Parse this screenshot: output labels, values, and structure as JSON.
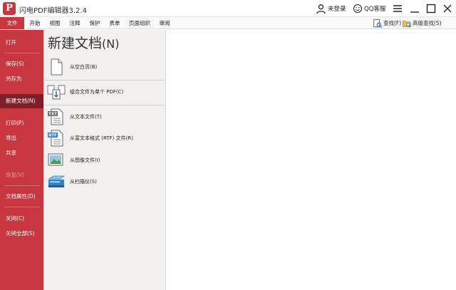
{
  "app": {
    "logo_letter": "P",
    "title": "闪电PDF编辑器3.2.4",
    "login_label": "未登录",
    "qq_label": "QQ客服",
    "brand_color": "#c8373f"
  },
  "window_controls": {
    "icons": [
      "menu-icon",
      "minimize-icon",
      "maximize-icon",
      "close-icon"
    ]
  },
  "menubar": {
    "items": [
      "文件",
      "开始",
      "视图",
      "注释",
      "保护",
      "表单",
      "页面组织",
      "审阅"
    ],
    "active": "文件",
    "find_label": "查找(F)",
    "advanced_find_label": "高级查找(S)"
  },
  "sidebar": {
    "items": [
      {
        "label": "打开",
        "state": "normal"
      },
      {
        "label": "保存(S)",
        "state": "normal"
      },
      {
        "label": "另存为",
        "state": "normal"
      },
      {
        "label": "新建文档(N)",
        "state": "active"
      },
      {
        "label": "打印(P)",
        "state": "normal"
      },
      {
        "label": "导出",
        "state": "normal"
      },
      {
        "label": "共享",
        "state": "normal"
      },
      {
        "label": "恢复(V)",
        "state": "disabled"
      },
      {
        "label": "文档属性(D)",
        "state": "normal"
      },
      {
        "label": "关闭(C)",
        "state": "normal"
      },
      {
        "label": "关闭全部(S)",
        "state": "normal"
      }
    ]
  },
  "panel": {
    "title": "新建文档",
    "title_key": "(N)",
    "options": [
      {
        "label": "从空白页(B)",
        "icon": "blank-page-icon"
      },
      {
        "label": "组合文件为单个 PDF(C)",
        "icon": "combine-files-icon"
      },
      {
        "label": "从文本文件(T)",
        "icon": "txt-file-icon"
      },
      {
        "label": "从富文本格式 (RTF) 文件(R)",
        "icon": "rtf-file-icon"
      },
      {
        "label": "从图像文件(I)",
        "icon": "image-file-icon"
      },
      {
        "label": "从扫描仪(S)",
        "icon": "scanner-icon"
      }
    ]
  }
}
